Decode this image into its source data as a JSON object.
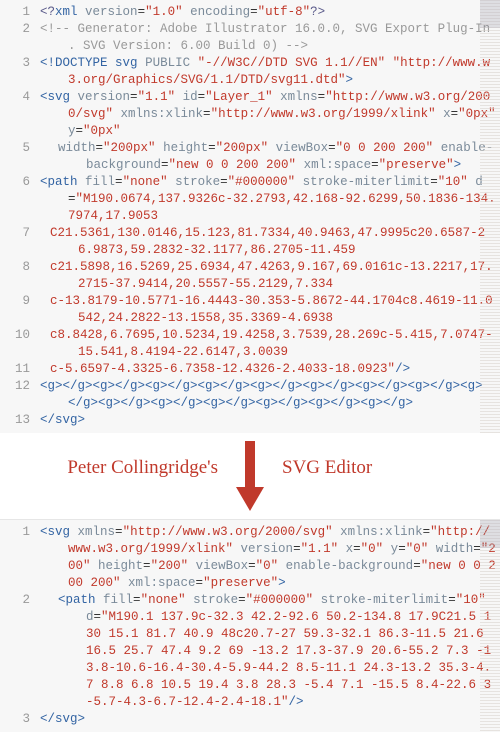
{
  "top": {
    "lines": [
      {
        "n": "1",
        "cls": "",
        "html": [
          [
            "pi",
            "<?"
          ],
          [
            "tag",
            "xml"
          ],
          [
            "txt",
            " "
          ],
          [
            "attr",
            "version"
          ],
          [
            "txt",
            "="
          ],
          [
            "str",
            "\"1.0\""
          ],
          [
            "txt",
            " "
          ],
          [
            "attr",
            "encoding"
          ],
          [
            "txt",
            "="
          ],
          [
            "str",
            "\"utf-8\""
          ],
          [
            "pi",
            "?>"
          ]
        ]
      },
      {
        "n": "2",
        "cls": "",
        "html": [
          [
            "cm",
            "<!-- Generator: Adobe Illustrator 16.0.0, SVG Export Plug-In . SVG Version: 6.00 Build 0)  -->"
          ]
        ]
      },
      {
        "n": "3",
        "cls": "",
        "html": [
          [
            "kw",
            "<!DOCTYPE"
          ],
          [
            "txt",
            " "
          ],
          [
            "tag",
            "svg"
          ],
          [
            "txt",
            " "
          ],
          [
            "attr",
            "PUBLIC"
          ],
          [
            "txt",
            " "
          ],
          [
            "str",
            "\"-//W3C//DTD SVG 1.1//EN\""
          ],
          [
            "txt",
            " "
          ],
          [
            "str",
            "\"http://www.w3.org/Graphics/SVG/1.1/DTD/svg11.dtd\""
          ],
          [
            "kw",
            ">"
          ]
        ]
      },
      {
        "n": "4",
        "cls": "",
        "html": [
          [
            "tag",
            "<svg"
          ],
          [
            "txt",
            " "
          ],
          [
            "attr",
            "version"
          ],
          [
            "txt",
            "="
          ],
          [
            "str",
            "\"1.1\""
          ],
          [
            "txt",
            " "
          ],
          [
            "attr",
            "id"
          ],
          [
            "txt",
            "="
          ],
          [
            "str",
            "\"Layer_1\""
          ],
          [
            "txt",
            " "
          ],
          [
            "attr",
            "xmlns"
          ],
          [
            "txt",
            "="
          ],
          [
            "str",
            "\"http://www.w3.org/2000/svg\""
          ],
          [
            "txt",
            " "
          ],
          [
            "attr",
            "xmlns:xlink"
          ],
          [
            "txt",
            "="
          ],
          [
            "str",
            "\"http://www.w3.org/1999/xlink\""
          ],
          [
            "txt",
            " "
          ],
          [
            "attr",
            "x"
          ],
          [
            "txt",
            "="
          ],
          [
            "str",
            "\"0px\""
          ],
          [
            "txt",
            " "
          ],
          [
            "attr",
            "y"
          ],
          [
            "txt",
            "="
          ],
          [
            "str",
            "\"0px\""
          ]
        ]
      },
      {
        "n": "5",
        "cls": "ind1",
        "html": [
          [
            "attr",
            "width"
          ],
          [
            "txt",
            "="
          ],
          [
            "str",
            "\"200px\""
          ],
          [
            "txt",
            " "
          ],
          [
            "attr",
            "height"
          ],
          [
            "txt",
            "="
          ],
          [
            "str",
            "\"200px\""
          ],
          [
            "txt",
            " "
          ],
          [
            "attr",
            "viewBox"
          ],
          [
            "txt",
            "="
          ],
          [
            "str",
            "\"0 0 200 200\""
          ],
          [
            "txt",
            " "
          ],
          [
            "attr",
            "enable-background"
          ],
          [
            "txt",
            "="
          ],
          [
            "str",
            "\"new 0 0 200 200\""
          ],
          [
            "txt",
            " "
          ],
          [
            "attr",
            "xml:space"
          ],
          [
            "txt",
            "="
          ],
          [
            "str",
            "\"preserve\""
          ],
          [
            "tag",
            ">"
          ]
        ]
      },
      {
        "n": "6",
        "cls": "",
        "html": [
          [
            "tag",
            "<path"
          ],
          [
            "txt",
            " "
          ],
          [
            "attr",
            "fill"
          ],
          [
            "txt",
            "="
          ],
          [
            "str",
            "\"none\""
          ],
          [
            "txt",
            " "
          ],
          [
            "attr",
            "stroke"
          ],
          [
            "txt",
            "="
          ],
          [
            "str",
            "\"#000000\""
          ],
          [
            "txt",
            " "
          ],
          [
            "attr",
            "stroke-miterlimit"
          ],
          [
            "txt",
            "="
          ],
          [
            "str",
            "\"10\""
          ],
          [
            "txt",
            " "
          ],
          [
            "attr",
            "d"
          ],
          [
            "txt",
            "="
          ],
          [
            "str",
            "\"M190.0674,137.9326c-32.2793,42.168-92.6299,50.1836-134.7974,17.9053"
          ]
        ]
      },
      {
        "n": "7",
        "cls": "ind05",
        "html": [
          [
            "str",
            "C21.5361,130.0146,15.123,81.7334,40.9463,47.9995c20.6587-26.9873,59.2832-32.1177,86.2705-11.459"
          ]
        ]
      },
      {
        "n": "8",
        "cls": "ind05",
        "html": [
          [
            "str",
            "c21.5898,16.5269,25.6934,47.4263,9.167,69.0161c-13.2217,17.2715-37.9414,20.5557-55.2129,7.334"
          ]
        ]
      },
      {
        "n": "9",
        "cls": "ind05",
        "html": [
          [
            "str",
            "c-13.8179-10.5771-16.4443-30.353-5.8672-44.1704c8.4619-11.0542,24.2822-13.1558,35.3369-4.6938"
          ]
        ]
      },
      {
        "n": "10",
        "cls": "ind05",
        "html": [
          [
            "str",
            "c8.8428,6.7695,10.5234,19.4258,3.7539,28.269c-5.415,7.0747-15.541,8.4194-22.6147,3.0039"
          ]
        ]
      },
      {
        "n": "11",
        "cls": "ind05",
        "html": [
          [
            "str",
            "c-5.6597-4.3325-6.7358-12.4326-2.4033-18.0923\""
          ],
          [
            "tag",
            "/>"
          ]
        ]
      },
      {
        "n": "12",
        "cls": "",
        "html": [
          [
            "tag",
            "<g></g><g></g><g></g><g></g><g></g><g></g><g></g><g></g><g></g><g></g><g></g><g></g><g></g><g></g><g></g>"
          ]
        ]
      },
      {
        "n": "13",
        "cls": "",
        "html": [
          [
            "tag",
            "</svg>"
          ]
        ]
      }
    ]
  },
  "caption": {
    "left": "Peter Collingridge's",
    "right": "SVG Editor"
  },
  "bottom": {
    "lines": [
      {
        "n": "1",
        "cls": "",
        "html": [
          [
            "tag",
            "<svg"
          ],
          [
            "txt",
            " "
          ],
          [
            "attr",
            "xmlns"
          ],
          [
            "txt",
            "="
          ],
          [
            "str",
            "\"http://www.w3.org/2000/svg\""
          ],
          [
            "txt",
            " "
          ],
          [
            "attr",
            "xmlns:xlink"
          ],
          [
            "txt",
            "="
          ],
          [
            "str",
            "\"http://www.w3.org/1999/xlink\""
          ],
          [
            "txt",
            " "
          ],
          [
            "attr",
            "version"
          ],
          [
            "txt",
            "="
          ],
          [
            "str",
            "\"1.1\""
          ],
          [
            "txt",
            " "
          ],
          [
            "attr",
            "x"
          ],
          [
            "txt",
            "="
          ],
          [
            "str",
            "\"0\""
          ],
          [
            "txt",
            " "
          ],
          [
            "attr",
            "y"
          ],
          [
            "txt",
            "="
          ],
          [
            "str",
            "\"0\""
          ],
          [
            "txt",
            " "
          ],
          [
            "attr",
            "width"
          ],
          [
            "txt",
            "="
          ],
          [
            "str",
            "\"200\""
          ],
          [
            "txt",
            " "
          ],
          [
            "attr",
            "height"
          ],
          [
            "txt",
            "="
          ],
          [
            "str",
            "\"200\""
          ],
          [
            "txt",
            " "
          ],
          [
            "attr",
            "viewBox"
          ],
          [
            "txt",
            "="
          ],
          [
            "str",
            "\"0\""
          ],
          [
            "txt",
            " "
          ],
          [
            "attr",
            "enable-background"
          ],
          [
            "txt",
            "="
          ],
          [
            "str",
            "\"new 0 0 200 200\""
          ],
          [
            "txt",
            " "
          ],
          [
            "attr",
            "xml:space"
          ],
          [
            "txt",
            "="
          ],
          [
            "str",
            "\"preserve\""
          ],
          [
            "tag",
            ">"
          ]
        ]
      },
      {
        "n": "2",
        "cls": "ind1",
        "html": [
          [
            "tag",
            "<path"
          ],
          [
            "txt",
            " "
          ],
          [
            "attr",
            "fill"
          ],
          [
            "txt",
            "="
          ],
          [
            "str",
            "\"none\""
          ],
          [
            "txt",
            " "
          ],
          [
            "attr",
            "stroke"
          ],
          [
            "txt",
            "="
          ],
          [
            "str",
            "\"#000000\""
          ],
          [
            "txt",
            " "
          ],
          [
            "attr",
            "stroke-miterlimit"
          ],
          [
            "txt",
            "="
          ],
          [
            "str",
            "\"10\""
          ],
          [
            "txt",
            " "
          ],
          [
            "attr",
            "d"
          ],
          [
            "txt",
            "="
          ],
          [
            "str",
            "\"M190.1 137.9c-32.3 42.2-92.6 50.2-134.8 17.9C21.5 130 15.1 81.7 40.9 48c20.7-27 59.3-32.1 86.3-11.5 21.6 16.5 25.7 47.4 9.2 69 -13.2 17.3-37.9 20.6-55.2 7.3 -13.8-10.6-16.4-30.4-5.9-44.2 8.5-11.1 24.3-13.2 35.3-4.7 8.8 6.8 10.5 19.4 3.8 28.3 -5.4 7.1 -15.5 8.4-22.6 3 -5.7-4.3-6.7-12.4-2.4-18.1\""
          ],
          [
            "tag",
            "/>"
          ]
        ]
      },
      {
        "n": "3",
        "cls": "",
        "html": [
          [
            "tag",
            "</svg>"
          ]
        ]
      }
    ]
  }
}
